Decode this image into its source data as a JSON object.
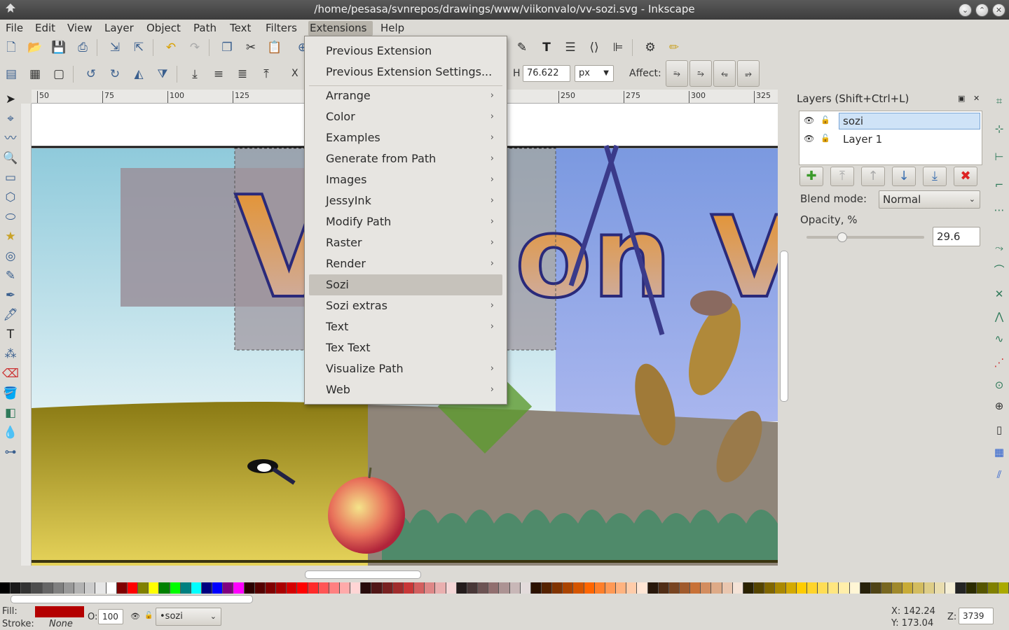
{
  "window": {
    "title": "/home/pesasa/svnrepos/drawings/www/viikonvalo/vv-sozi.svg - Inkscape"
  },
  "menubar": [
    "File",
    "Edit",
    "View",
    "Layer",
    "Object",
    "Path",
    "Text",
    "Filters",
    "Extensions",
    "Help"
  ],
  "toolbar2": {
    "x_label": "X",
    "h_label": "H",
    "h_value": "76.622",
    "unit": "px",
    "affect_label": "Affect:"
  },
  "ruler": {
    "h_ticks": [
      "50",
      "75",
      "100",
      "125",
      "250",
      "275",
      "300",
      "325"
    ]
  },
  "extensions_menu": {
    "top_items": [
      "Previous Extension",
      "Previous Extension Settings..."
    ],
    "items": [
      {
        "label": "Arrange",
        "submenu": true
      },
      {
        "label": "Color",
        "submenu": true
      },
      {
        "label": "Examples",
        "submenu": true
      },
      {
        "label": "Generate from Path",
        "submenu": true
      },
      {
        "label": "Images",
        "submenu": true
      },
      {
        "label": "JessyInk",
        "submenu": true
      },
      {
        "label": "Modify Path",
        "submenu": true
      },
      {
        "label": "Raster",
        "submenu": true
      },
      {
        "label": "Render",
        "submenu": true
      },
      {
        "label": "Sozi",
        "submenu": false,
        "highlighted": true
      },
      {
        "label": "Sozi extras",
        "submenu": true
      },
      {
        "label": "Text",
        "submenu": true
      },
      {
        "label": "Tex Text",
        "submenu": false
      },
      {
        "label": "Visualize Path",
        "submenu": true
      },
      {
        "label": "Web",
        "submenu": true
      }
    ]
  },
  "layers_panel": {
    "title": "Layers (Shift+Ctrl+L)",
    "layers": [
      {
        "name": "sozi",
        "selected": true
      },
      {
        "name": "Layer 1",
        "selected": false
      }
    ],
    "blend_label": "Blend mode:",
    "blend_value": "Normal",
    "opacity_label": "Opacity, %",
    "opacity_value": "29.6"
  },
  "statusbar": {
    "fill_label": "Fill:",
    "stroke_label": "Stroke:",
    "stroke_value": "None",
    "fill_color": "#b40000",
    "o_label": "O:",
    "o_value": "100",
    "layer_value": "•sozi",
    "x_coord": "X: 142.24",
    "y_coord": "Y: 173.04",
    "zoom_label": "Z:",
    "zoom_value": "3739"
  },
  "palette_colors": [
    "#000000",
    "#1a1a1a",
    "#333333",
    "#4d4d4d",
    "#666666",
    "#808080",
    "#999999",
    "#b3b3b3",
    "#cccccc",
    "#e6e6e6",
    "#ffffff",
    "#800000",
    "#ff0000",
    "#808000",
    "#ffff00",
    "#008000",
    "#00ff00",
    "#008080",
    "#00ffff",
    "#000080",
    "#0000ff",
    "#800080",
    "#ff00ff",
    "#2b0000",
    "#550000",
    "#800000",
    "#aa0000",
    "#d40000",
    "#ff0000",
    "#ff2a2a",
    "#ff5555",
    "#ff8080",
    "#ffaaaa",
    "#ffd5d5",
    "#280b0b",
    "#501616",
    "#782121",
    "#a02c2c",
    "#c83737",
    "#d35f5f",
    "#de8787",
    "#e9afaf",
    "#f4d7d7",
    "#241c1c",
    "#483737",
    "#6c5353",
    "#916f6f",
    "#ac9393",
    "#c8b7b7",
    "#e3dbdb",
    "#2b1100",
    "#552200",
    "#803300",
    "#aa4400",
    "#d45500",
    "#ff6600",
    "#ff7f2a",
    "#ff9955",
    "#ffb380",
    "#ffccaa",
    "#ffe6d5",
    "#28170b",
    "#502d16",
    "#784421",
    "#a05a2c",
    "#c87137",
    "#d38d5f",
    "#deaa87",
    "#e9c6af",
    "#f4e3d7",
    "#2b2200",
    "#554400",
    "#806600",
    "#aa8800",
    "#d4aa00",
    "#ffcc00",
    "#ffd42a",
    "#ffdd55",
    "#ffe680",
    "#ffeeaa",
    "#fff6d5",
    "#28220b",
    "#504416",
    "#786721",
    "#a0892c",
    "#c8ab37",
    "#d3bc5f",
    "#decd87",
    "#e9ddaf",
    "#f4eed7",
    "#242424",
    "#2b2b00",
    "#555500",
    "#808000",
    "#aaaa00"
  ]
}
